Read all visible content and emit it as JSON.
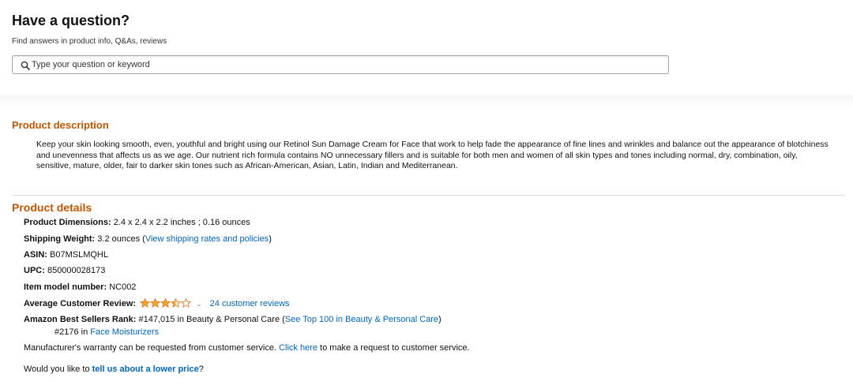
{
  "question": {
    "title": "Have a question?",
    "subtitle": "Find answers in product info, Q&As, reviews",
    "search_placeholder": "Type your question or keyword",
    "search_value": ""
  },
  "description": {
    "title": "Product description",
    "text": "Keep your skin looking smooth, even, youthful and bright using our Retinol Sun Damage Cream for Face that work to help fade the appearance of fine lines and wrinkles and balance out the appearance of blotchiness and unevenness that affects us as we age. Our nutrient rich formula contains NO unnecessary fillers and is suitable for both men and women of all skin types and tones including normal, dry, combination, oily, sensitive, mature, older, fair to darker skin tones such as African-American, Asian, Latin, Indian and Mediterranean."
  },
  "details": {
    "title": "Product details",
    "dimensions_label": "Product Dimensions:",
    "dimensions_value": "2.4 x 2.4 x 2.2 inches ; 0.16 ounces",
    "weight_label": "Shipping Weight:",
    "weight_value": "3.2 ounces (",
    "weight_link": "View shipping rates and policies",
    "weight_close": ")",
    "asin_label": "ASIN:",
    "asin_value": "B07MSLMQHL",
    "upc_label": "UPC:",
    "upc_value": "850000028173",
    "model_label": "Item model number:",
    "model_value": "NC002",
    "review_label": "Average Customer Review:",
    "review_rating": 3.5,
    "review_count_link": "24 customer reviews",
    "rank_label": "Amazon Best Sellers Rank:",
    "rank_value": "#147,015 in Beauty & Personal Care (",
    "rank_link": "See Top 100 in Beauty & Personal Care",
    "rank_close": ")",
    "subrank_value": "#2176 in",
    "subrank_link": "Face Moisturizers",
    "warranty_text": "Manufacturer's warranty can be requested from customer service.",
    "warranty_link": "Click here",
    "warranty_text2": "to make a request to customer service.",
    "lower_price_text": "Would you like to",
    "lower_price_link": "tell us about a lower price",
    "lower_price_end": "?"
  },
  "colors": {
    "heading": "#c45500",
    "link": "#0066c0",
    "star": "#ffa41c"
  },
  "icons": {
    "search": "search-icon",
    "star": "star-icon",
    "chevron": "chevron-down-icon"
  }
}
